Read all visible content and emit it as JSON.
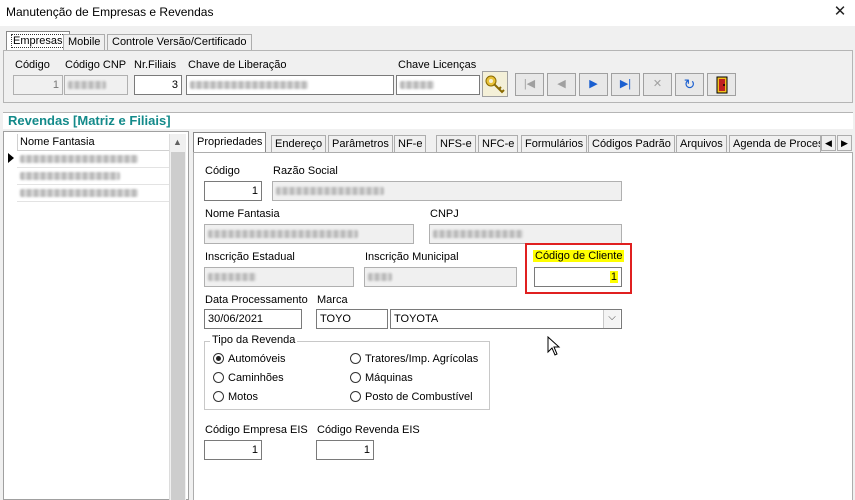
{
  "window": {
    "title": "Manutenção de Empresas e Revendas",
    "close_symbol": "✕"
  },
  "top_tabs": [
    "Empresas",
    "Mobile",
    "Controle Versão/Certificado"
  ],
  "top_fields": {
    "codigo_label": "Código",
    "codigo_value": "1",
    "codigo_cnp_label": "Código CNP",
    "nr_filiais_label": "Nr.Filiais",
    "nr_filiais_value": "3",
    "chave_liberacao_label": "Chave de Liberação",
    "chave_licencas_label": "Chave Licenças"
  },
  "nav_buttons": [
    "|◀",
    "◀",
    "▶",
    "▶|",
    "✕",
    "↻"
  ],
  "section_title": "Revendas [Matriz e Filiais]",
  "grid": {
    "header": "Nome Fantasia",
    "row_count": 3
  },
  "prop_tabs": [
    "Propriedades",
    "Endereço",
    "Parâmetros",
    "NF-e",
    "NFS-e",
    "NFC-e",
    "Formulários",
    "Códigos Padrão",
    "Arquivos",
    "Agenda de Proces"
  ],
  "form": {
    "codigo_label": "Código",
    "codigo_value": "1",
    "razao_social_label": "Razão Social",
    "nome_fantasia_label": "Nome Fantasia",
    "cnpj_label": "CNPJ",
    "inscricao_estadual_label": "Inscrição Estadual",
    "inscricao_municipal_label": "Inscrição Municipal",
    "codigo_cliente_label": "Código de Cliente",
    "codigo_cliente_value": "1",
    "data_processamento_label": "Data Processamento",
    "data_processamento_value": "30/06/2021",
    "marca_label": "Marca",
    "marca_code": "TOYO",
    "marca_name": "TOYOTA",
    "tipo_revenda_label": "Tipo da Revenda",
    "tipo_revenda_options": [
      "Automóveis",
      "Caminhões",
      "Motos",
      "Tratores/Imp. Agrícolas",
      "Máquinas",
      "Posto de Combustível"
    ],
    "tipo_revenda_selected": "Automóveis",
    "codigo_empresa_eis_label": "Código Empresa EIS",
    "codigo_empresa_eis_value": "1",
    "codigo_revenda_eis_label": "Código Revenda EIS",
    "codigo_revenda_eis_value": "1"
  },
  "colors": {
    "section_title": "#138a8a",
    "highlight_border": "#e02020",
    "highlight_fill": "#ffff00",
    "nav_blue": "#1a5fd0"
  }
}
